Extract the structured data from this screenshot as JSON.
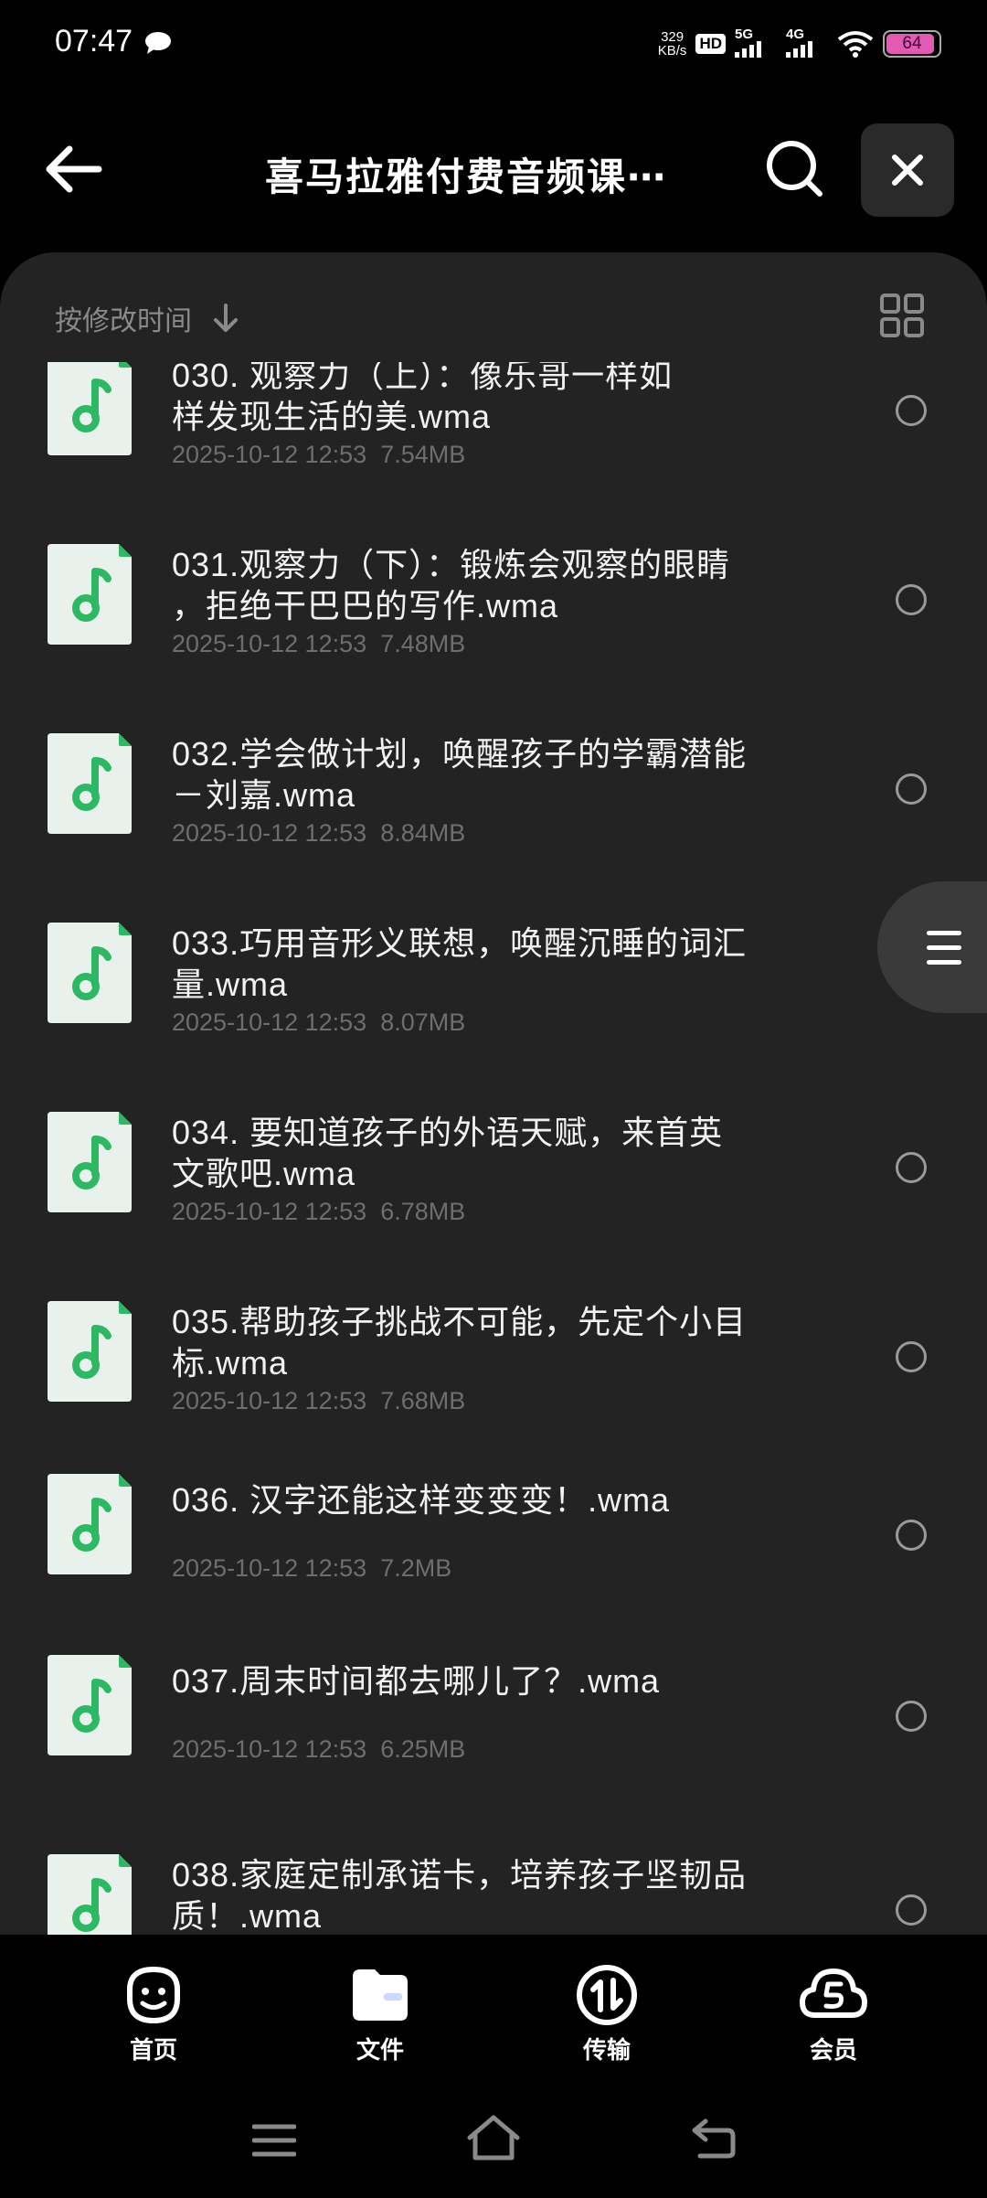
{
  "status_bar": {
    "time": "07:47",
    "net_speed_value": "329",
    "net_speed_unit": "KB/s",
    "hd_label": "HD",
    "signal_1": "5G",
    "signal_2": "4G",
    "battery": "64"
  },
  "header": {
    "title": "喜马拉雅付费音频课⋯"
  },
  "toolbar": {
    "sort_label": "按修改时间"
  },
  "files": [
    {
      "name_line1": "030. 观察力（上）：像乐哥一样如",
      "name_line2": "样发现生活的美.wma",
      "date": "2025-10-12 12:53",
      "size": "7.54MB"
    },
    {
      "name_line1": "031.观察力（下）：锻炼会观察的眼睛",
      "name_line2": "，拒绝干巴巴的写作.wma",
      "date": "2025-10-12 12:53",
      "size": "7.48MB"
    },
    {
      "name_line1": "032.学会做计划，唤醒孩子的学霸潜能",
      "name_line2": "－刘嘉.wma",
      "date": "2025-10-12 12:53",
      "size": "8.84MB"
    },
    {
      "name_line1": "033.巧用音形义联想，唤醒沉睡的词汇",
      "name_line2": "量.wma",
      "date": "2025-10-12 12:53",
      "size": "8.07MB"
    },
    {
      "name_line1": "034. 要知道孩子的外语天赋，来首英",
      "name_line2": "文歌吧.wma",
      "date": "2025-10-12 12:53",
      "size": "6.78MB"
    },
    {
      "name_line1": "035.帮助孩子挑战不可能，先定个小目",
      "name_line2": "标.wma",
      "date": "2025-10-12 12:53",
      "size": "7.68MB"
    },
    {
      "name_line1": "036. 汉字还能这样变变变！.wma",
      "name_line2": "",
      "date": "2025-10-12 12:53",
      "size": "7.2MB"
    },
    {
      "name_line1": "037.周末时间都去哪儿了？.wma",
      "name_line2": "",
      "date": "2025-10-12 12:53",
      "size": "6.25MB"
    },
    {
      "name_line1": "038.家庭定制承诺卡，培养孩子坚韧品",
      "name_line2": "质！.wma",
      "date": "",
      "size": ""
    }
  ],
  "bottom_nav": [
    {
      "label": "首页",
      "icon": "home-face-icon"
    },
    {
      "label": "文件",
      "icon": "folder-icon"
    },
    {
      "label": "传输",
      "icon": "transfer-icon"
    },
    {
      "label": "会员",
      "icon": "vip-cloud-icon"
    }
  ],
  "colors": {
    "accent_green": "#2fb864",
    "panel_bg": "#232323",
    "file_icon_bg": "#e9f1ec"
  }
}
